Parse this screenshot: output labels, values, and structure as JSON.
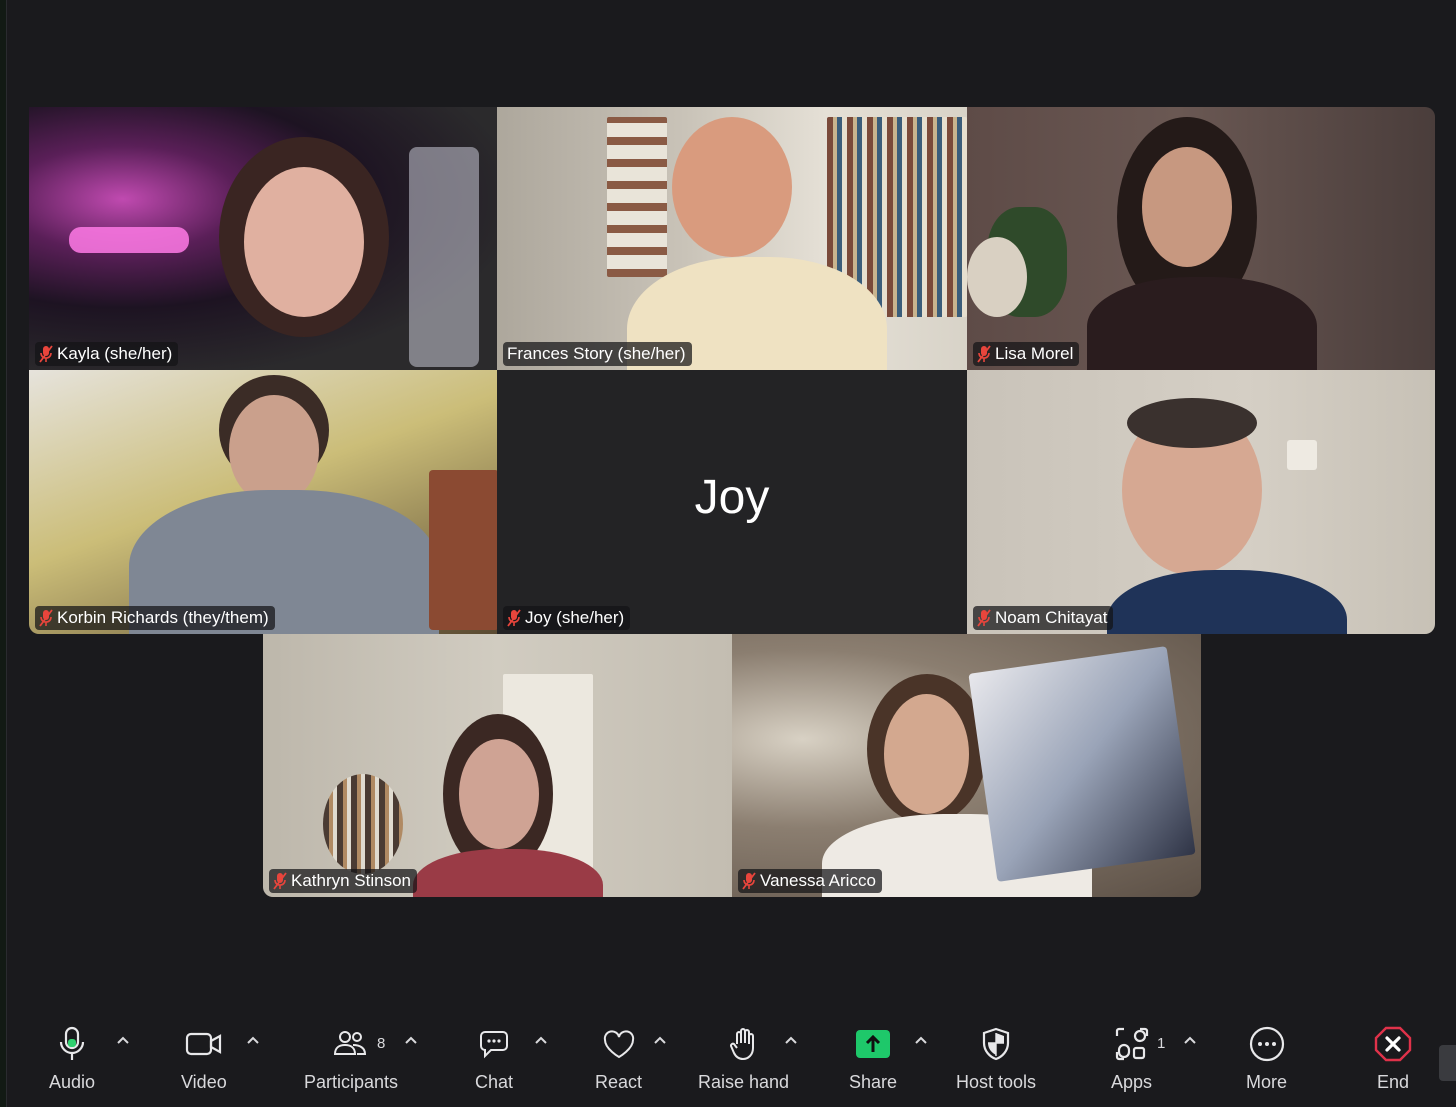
{
  "participants": [
    {
      "name": "Kayla (she/her)"
    },
    {
      "name": "Frances Story (she/her)"
    },
    {
      "name": "Lisa Morel"
    },
    {
      "name": "Korbin Richards (they/them)"
    },
    {
      "name": "Joy (she/her)",
      "display_name": "Joy"
    },
    {
      "name": "Noam Chitayat"
    },
    {
      "name": "Kathryn Stinson"
    },
    {
      "name": "Vanessa Aricco"
    }
  ],
  "toolbar": {
    "audio": "Audio",
    "video": "Video",
    "participants": "Participants",
    "participants_count": "8",
    "chat": "Chat",
    "react": "React",
    "raise_hand": "Raise hand",
    "share": "Share",
    "host_tools": "Host tools",
    "apps": "Apps",
    "apps_count": "1",
    "more": "More",
    "end": "End"
  },
  "colors": {
    "active_speaker": "#4ec754",
    "share_green": "#1ec86a",
    "end_red": "#e0324a",
    "muted_red": "#e8453c"
  }
}
